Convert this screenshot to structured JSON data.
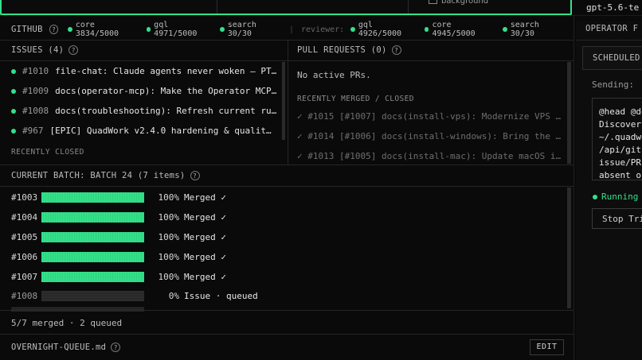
{
  "top": {
    "checkbox_label": "background",
    "model": "gpt-5.6-te"
  },
  "github": {
    "title": "GITHUB",
    "limits": [
      {
        "label": "core 3834/5000"
      },
      {
        "label": "gql 4971/5000"
      },
      {
        "label": "search 30/30"
      }
    ],
    "reviewer_label": "reviewer:",
    "reviewer_limits": [
      {
        "label": "gql 4926/5000"
      },
      {
        "label": "core 4945/5000"
      },
      {
        "label": "search 30/30"
      }
    ]
  },
  "issues": {
    "title": "ISSUES (4)",
    "items": [
      {
        "num": "#1010",
        "title": "file-chat: Claude agents never woken — PT…"
      },
      {
        "num": "#1009",
        "title": "docs(operator-mcp): Make the Operator MCP…"
      },
      {
        "num": "#1008",
        "title": "docs(troubleshooting): Refresh current ru…"
      },
      {
        "num": "#967",
        "title": "[EPIC] QuadWork v2.4.0 hardening & qualit…"
      }
    ],
    "recently_closed": "RECENTLY CLOSED"
  },
  "pull_requests": {
    "title": "PULL REQUESTS (0)",
    "empty": "No active PRs.",
    "recent_title": "RECENTLY MERGED / CLOSED",
    "recent": [
      {
        "text": "✓ #1015 [#1007] docs(install-vps): Modernize VPS …"
      },
      {
        "text": "✓ #1014 [#1006] docs(install-windows): Bring the …"
      },
      {
        "text": "✓ #1013 [#1005] docs(install-mac): Update macOS i…"
      }
    ]
  },
  "batch": {
    "title": "CURRENT BATCH: BATCH 24 (7 items)",
    "rows": [
      {
        "num": "#1003",
        "progress": 100,
        "pct": "100%",
        "status": "Merged ✓"
      },
      {
        "num": "#1004",
        "progress": 100,
        "pct": "100%",
        "status": "Merged ✓"
      },
      {
        "num": "#1005",
        "progress": 100,
        "pct": "100%",
        "status": "Merged ✓"
      },
      {
        "num": "#1006",
        "progress": 100,
        "pct": "100%",
        "status": "Merged ✓"
      },
      {
        "num": "#1007",
        "progress": 100,
        "pct": "100%",
        "status": "Merged ✓"
      },
      {
        "num": "#1008",
        "progress": 0,
        "pct": "0%",
        "status": "Issue · queued"
      }
    ],
    "summary": "5/7 merged · 2 queued"
  },
  "queue": {
    "title": "OVERNIGHT-QUEUE.md",
    "edit_label": "EDIT"
  },
  "operator": {
    "title": "OPERATOR F",
    "scheduled_title": "SCHEDULED",
    "sending_label": "Sending:",
    "message_lines": [
      "@head @de",
      "Discovery",
      "~/.quadwo",
      "/api/gith",
      "issue/PR",
      "absent o"
    ],
    "running_label": "Running",
    "stop_label": "Stop Tri"
  },
  "colors": {
    "accent": "#33e08a",
    "background": "#0a0a0a"
  }
}
